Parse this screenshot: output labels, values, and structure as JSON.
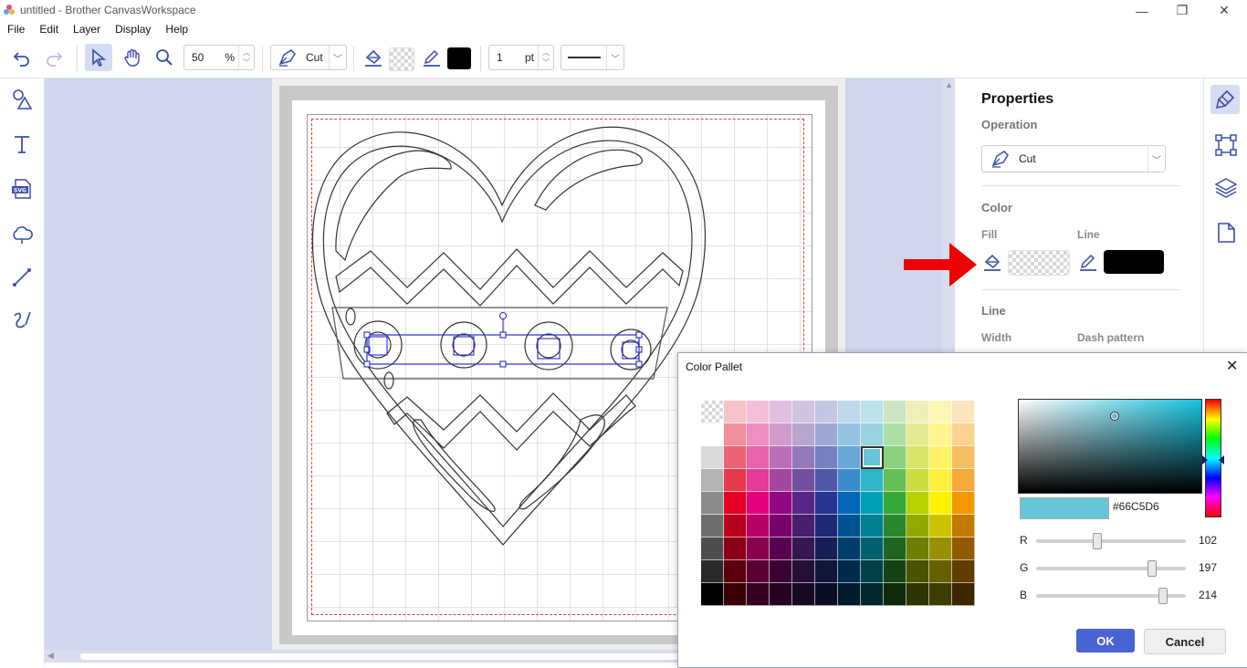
{
  "window": {
    "title": "untitled - Brother CanvasWorkspace",
    "minimize": "—",
    "restore": "❐",
    "close": "✕"
  },
  "menu": [
    "File",
    "Edit",
    "Layer",
    "Display",
    "Help"
  ],
  "toolbar": {
    "zoom_value": "50",
    "zoom_unit": "%",
    "operation": "Cut",
    "line_width": "1",
    "line_width_unit": "pt"
  },
  "properties": {
    "title": "Properties",
    "operation_label": "Operation",
    "operation_value": "Cut",
    "color_label": "Color",
    "fill_label": "Fill",
    "line_color_label": "Line",
    "line_section_label": "Line",
    "width_label": "Width",
    "dash_label": "Dash pattern",
    "line_color": "#000000"
  },
  "dialog": {
    "title": "Color Pallet",
    "close": "✕",
    "hex": "#66C5D6",
    "current_color": "#66C5D6",
    "r_label": "R",
    "r_value": "102",
    "r_level": 0.4,
    "g_label": "G",
    "g_value": "197",
    "g_level": 0.77,
    "b_label": "B",
    "b_value": "214",
    "b_level": 0.84,
    "ok": "OK",
    "cancel": "Cancel",
    "swatches": [
      [
        "checker",
        "#f7c3c7",
        "#f5bdd9",
        "#dfbfdf",
        "#cfc3de",
        "#c3c7e1",
        "#bdd8eb",
        "#bde3ea",
        "#cce6c4",
        "#eef0b8",
        "#fdf7b4",
        "#fde5bf"
      ],
      [
        "#ffffff",
        "#f0909d",
        "#ee8fc0",
        "#cf9bcc",
        "#b6a5cd",
        "#9ea8d3",
        "#95c2e3",
        "#99d3df",
        "#ace0a7",
        "#e5ea92",
        "#fef58d",
        "#fbd391"
      ],
      [
        "#d9d9d9",
        "#ec6474",
        "#ea62aa",
        "#b970b7",
        "#9479bb",
        "#7581c2",
        "#68a8d8",
        "#66c5d6",
        "#8ccf7f",
        "#d9e36a",
        "#fff266",
        "#f8be62"
      ],
      [
        "#b3b3b3",
        "#e83a4f",
        "#e6399a",
        "#a3479f",
        "#73509f",
        "#5058a7",
        "#3b8dca",
        "#33b5c9",
        "#66bf55",
        "#cddc3f",
        "#fff03d",
        "#f6a838"
      ],
      [
        "#8c8c8c",
        "#e60026",
        "#e5007e",
        "#920783",
        "#5a2588",
        "#263592",
        "#0068b7",
        "#00a0b7",
        "#34a834",
        "#b8d200",
        "#fff100",
        "#f39800"
      ],
      [
        "#6e6e6e",
        "#b8001e",
        "#b80068",
        "#77046b",
        "#481e6d",
        "#1e2a75",
        "#005393",
        "#008093",
        "#2a862a",
        "#93a800",
        "#ccc100",
        "#c27a00"
      ],
      [
        "#4d4d4d",
        "#8a0017",
        "#8a004e",
        "#590350",
        "#361752",
        "#171f58",
        "#003e6e",
        "#00606e",
        "#1f651f",
        "#6e7e00",
        "#998f00",
        "#925b00"
      ],
      [
        "#2b2b2b",
        "#5c000f",
        "#5c0034",
        "#3b0235",
        "#240f37",
        "#0f153b",
        "#002a49",
        "#004049",
        "#154315",
        "#4a5400",
        "#666000",
        "#613d00"
      ],
      [
        "#000000",
        "#3a0009",
        "#3a0021",
        "#250122",
        "#170922",
        "#090d25",
        "#001a2e",
        "#00282e",
        "#0d2a0d",
        "#2e3500",
        "#403c00",
        "#3d2600"
      ]
    ],
    "selected_swatch": [
      2,
      7
    ]
  }
}
